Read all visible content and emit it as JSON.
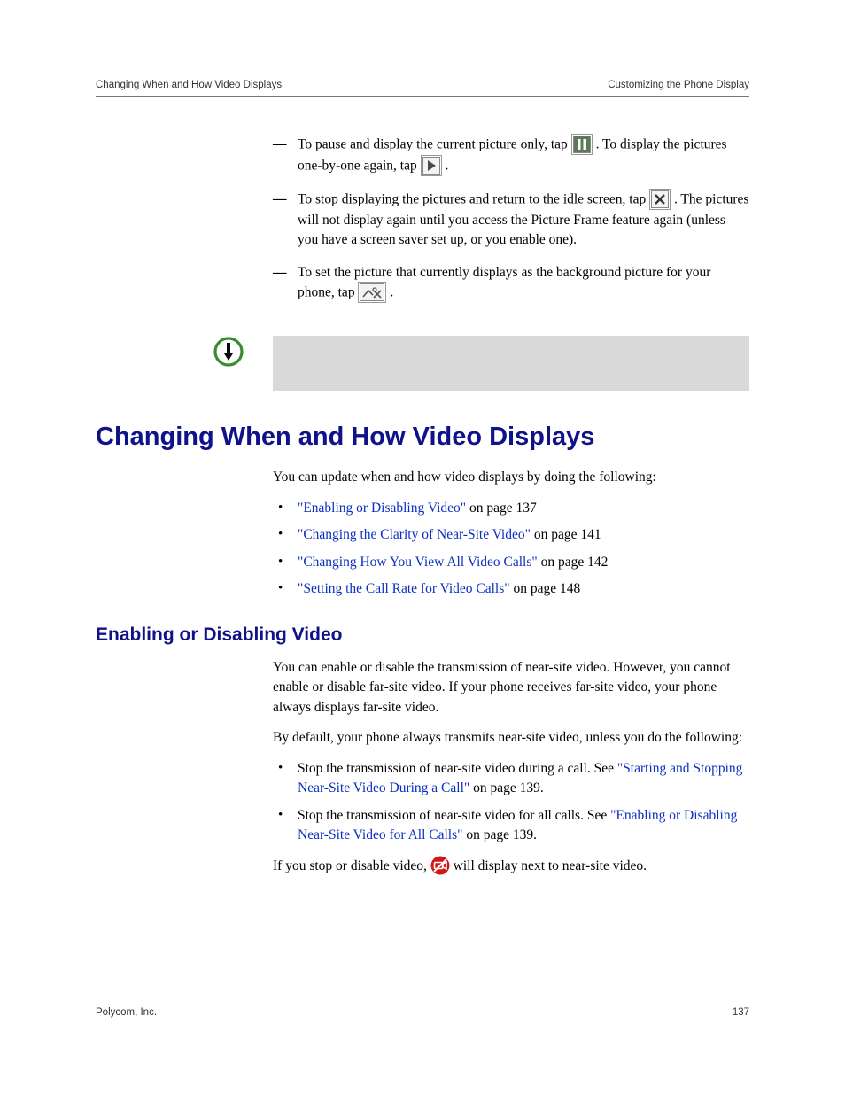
{
  "header": {
    "left": "Changing When and How Video Displays",
    "right": "Customizing the Phone Display"
  },
  "picture_frame": {
    "pause_pre": "To pause and display the current picture only, tap ",
    "pause_post": ". To display the pictures one-by-one again, tap ",
    "pause_end": ".",
    "stop_pre": "To stop displaying the pictures and return to the idle screen, tap ",
    "stop_post": ". The pictures will not display again until you access the Picture Frame feature again (unless you have a screen saver set up, or you enable one).",
    "bg_pre": "To set the picture that currently displays as the background picture for your phone, tap ",
    "bg_post": "."
  },
  "h1": "Changing When and How Video Displays",
  "intro": "You can update when and how video displays by doing the following:",
  "toc": {
    "i1_link": "\"Enabling or Disabling Video\"",
    "i1_tail": " on page 137",
    "i2_link": "\"Changing the Clarity of Near-Site Video\"",
    "i2_tail": " on page 141",
    "i3_link": "\"Changing How You View All Video Calls\"",
    "i3_tail": " on page 142",
    "i4_link": "\"Setting the Call Rate for Video Calls\"",
    "i4_tail": " on page 148"
  },
  "h2": "Enabling or Disabling Video",
  "enable_p1": "You can enable or disable the transmission of near-site video. However, you cannot enable or disable far-site video. If your phone receives far-site video, your phone always displays far-site video.",
  "enable_p2": "By default, your phone always transmits near-site video, unless you do the following:",
  "enable_list": {
    "i1_pre": "Stop the transmission of near-site video during a call. See ",
    "i1_link": "\"Starting and Stopping Near-Site Video During a Call\"",
    "i1_tail": " on page 139.",
    "i2_pre": "Stop the transmission of near-site video for all calls. See ",
    "i2_link": "\"Enabling or Disabling Near-Site Video for All Calls\"",
    "i2_tail": " on page 139."
  },
  "stopline": {
    "pre": "If you stop or disable video, ",
    "post": " will display next to near-site video."
  },
  "footer": {
    "left": "Polycom, Inc.",
    "right": "137"
  }
}
